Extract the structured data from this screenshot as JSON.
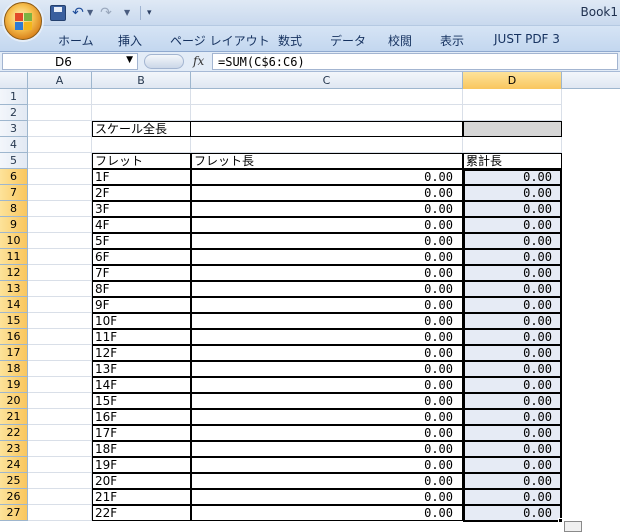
{
  "window": {
    "title": "Book1"
  },
  "quick_access": {
    "undo_icon": "undo-icon",
    "redo_icon": "redo-icon",
    "save_icon": "save-icon",
    "customize_label": "▾"
  },
  "ribbon": {
    "tabs": [
      "ホーム",
      "挿入",
      "ページ レイアウト",
      "数式",
      "データ",
      "校閲",
      "表示",
      "JUST PDF 3"
    ]
  },
  "formula_bar": {
    "name_box": "D6",
    "fx_label": "fx",
    "formula": "=SUM(C$6:C6)"
  },
  "columns": [
    "A",
    "B",
    "C",
    "D"
  ],
  "active_column": "D",
  "rows": [
    1,
    2,
    3,
    4,
    5,
    6,
    7,
    8,
    9,
    10,
    11,
    12,
    13,
    14,
    15,
    16,
    17,
    18,
    19,
    20,
    21,
    22,
    23,
    24,
    25,
    26,
    27
  ],
  "active_rows_from": 6,
  "sheet": {
    "scale_label": "スケール全長",
    "scale_value": "",
    "header": {
      "fret": "フレット",
      "fret_length": "フレット長",
      "cumulative": "累計長"
    },
    "frets": [
      {
        "name": "1F",
        "length": "0.00",
        "cumulative": "0.00"
      },
      {
        "name": "2F",
        "length": "0.00",
        "cumulative": "0.00"
      },
      {
        "name": "3F",
        "length": "0.00",
        "cumulative": "0.00"
      },
      {
        "name": "4F",
        "length": "0.00",
        "cumulative": "0.00"
      },
      {
        "name": "5F",
        "length": "0.00",
        "cumulative": "0.00"
      },
      {
        "name": "6F",
        "length": "0.00",
        "cumulative": "0.00"
      },
      {
        "name": "7F",
        "length": "0.00",
        "cumulative": "0.00"
      },
      {
        "name": "8F",
        "length": "0.00",
        "cumulative": "0.00"
      },
      {
        "name": "9F",
        "length": "0.00",
        "cumulative": "0.00"
      },
      {
        "name": "10F",
        "length": "0.00",
        "cumulative": "0.00"
      },
      {
        "name": "11F",
        "length": "0.00",
        "cumulative": "0.00"
      },
      {
        "name": "12F",
        "length": "0.00",
        "cumulative": "0.00"
      },
      {
        "name": "13F",
        "length": "0.00",
        "cumulative": "0.00"
      },
      {
        "name": "14F",
        "length": "0.00",
        "cumulative": "0.00"
      },
      {
        "name": "15F",
        "length": "0.00",
        "cumulative": "0.00"
      },
      {
        "name": "16F",
        "length": "0.00",
        "cumulative": "0.00"
      },
      {
        "name": "17F",
        "length": "0.00",
        "cumulative": "0.00"
      },
      {
        "name": "18F",
        "length": "0.00",
        "cumulative": "0.00"
      },
      {
        "name": "19F",
        "length": "0.00",
        "cumulative": "0.00"
      },
      {
        "name": "20F",
        "length": "0.00",
        "cumulative": "0.00"
      },
      {
        "name": "21F",
        "length": "0.00",
        "cumulative": "0.00"
      },
      {
        "name": "22F",
        "length": "0.00",
        "cumulative": "0.00"
      }
    ]
  },
  "colors": {
    "selection_fill": "#e6ebf5",
    "gray_cell": "#d6d6d6",
    "header_highlight": "#f9c65e"
  }
}
